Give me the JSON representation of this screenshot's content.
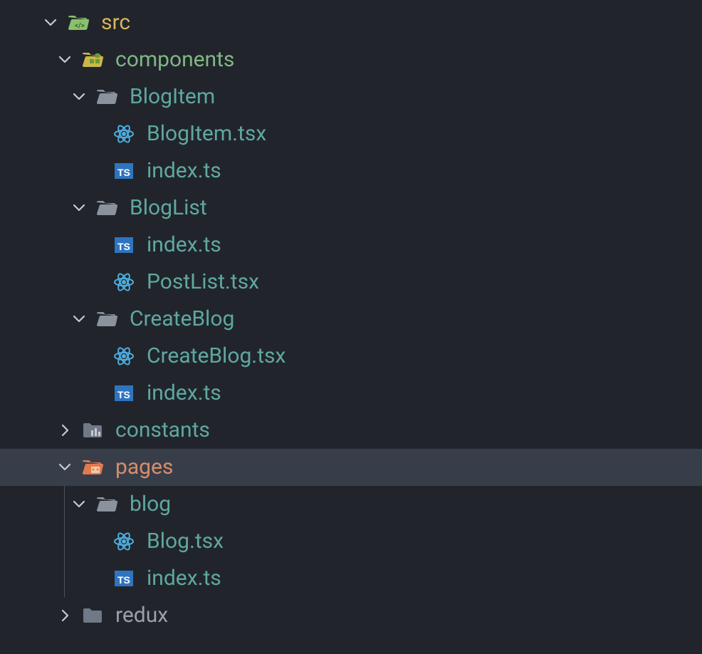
{
  "tree": {
    "src": "src",
    "components": "components",
    "blogItem": "BlogItem",
    "blogItemTsx": "BlogItem.tsx",
    "indexTs1": "index.ts",
    "blogList": "BlogList",
    "indexTs2": "index.ts",
    "postListTsx": "PostList.tsx",
    "createBlog": "CreateBlog",
    "createBlogTsx": "CreateBlog.tsx",
    "indexTs3": "index.ts",
    "constants": "constants",
    "pages": "pages",
    "blog": "blog",
    "blogTsx": "Blog.tsx",
    "indexTs4": "index.ts",
    "redux": "redux"
  },
  "colors": {
    "src": "#8ac06d",
    "components": "#b7c95b",
    "folderTeal": "#5fa8a0",
    "react": "#4faee0",
    "ts": "#2f74c0",
    "pages": "#e07b4f",
    "constantsIcon": "#7a8494",
    "reduxIcon": "#7a8494"
  }
}
